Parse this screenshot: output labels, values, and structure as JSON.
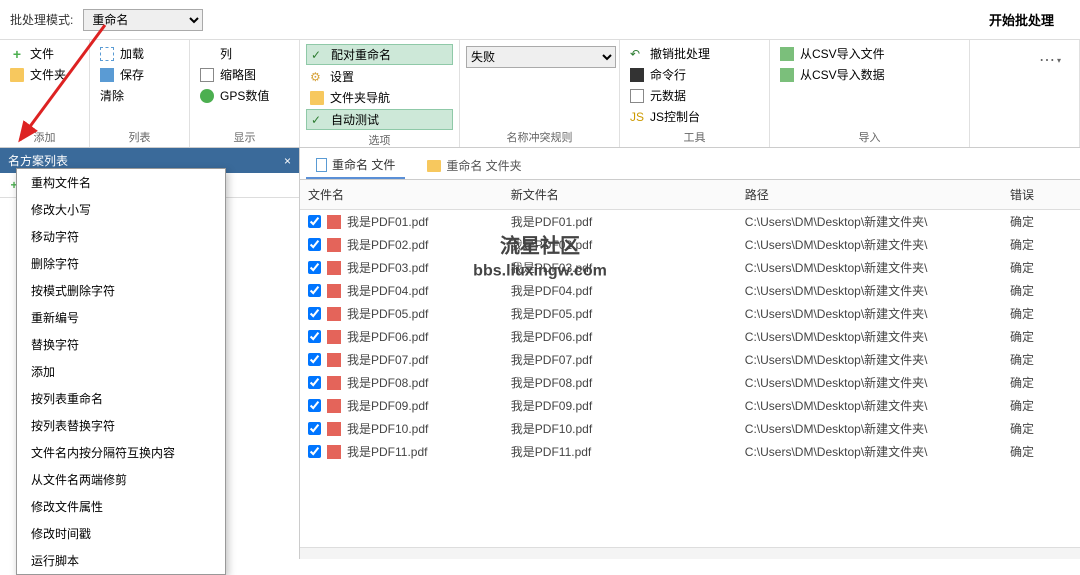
{
  "top": {
    "mode_label": "批处理模式:",
    "mode_value": "重命名",
    "start": "开始批处理"
  },
  "ribbon": {
    "add": {
      "label": "添加",
      "file": "文件",
      "folder": "文件夹"
    },
    "list": {
      "label": "列表",
      "load": "加载",
      "save": "保存",
      "clear": "清除"
    },
    "disp": {
      "label": "显示",
      "col": "列",
      "thumb": "缩略图",
      "gps": "GPS数值"
    },
    "opt": {
      "label": "选项",
      "pair": "配对重命名",
      "set": "设置",
      "nav": "文件夹导航",
      "auto": "自动测试"
    },
    "rule": {
      "label": "名称冲突规则",
      "fail": "失败"
    },
    "tool": {
      "label": "工具",
      "undo": "撤销批处理",
      "cmd": "命令行",
      "meta": "元数据",
      "js": "JS控制台"
    },
    "imp": {
      "label": "导入",
      "csvf": "从CSV导入文件",
      "csvd": "从CSV导入数据"
    }
  },
  "panel": {
    "title": "名方案列表"
  },
  "menu": [
    "重构文件名",
    "修改大小写",
    "移动字符",
    "删除字符",
    "按模式删除字符",
    "重新编号",
    "替换字符",
    "添加",
    "按列表重命名",
    "按列表替换字符",
    "文件名内按分隔符互换内容",
    "从文件名两端修剪",
    "修改文件属性",
    "修改时间戳",
    "运行脚本"
  ],
  "tabs": {
    "files": "重命名 文件",
    "folders": "重命名 文件夹"
  },
  "cols": {
    "name": "文件名",
    "newname": "新文件名",
    "path": "路径",
    "err": "错误"
  },
  "rows": [
    {
      "n": "我是PDF01.pdf",
      "nn": "我是PDF01.pdf",
      "p": "C:\\Users\\DM\\Desktop\\新建文件夹\\",
      "e": "确定"
    },
    {
      "n": "我是PDF02.pdf",
      "nn": "我是PDF02.pdf",
      "p": "C:\\Users\\DM\\Desktop\\新建文件夹\\",
      "e": "确定"
    },
    {
      "n": "我是PDF03.pdf",
      "nn": "我是PDF03.pdf",
      "p": "C:\\Users\\DM\\Desktop\\新建文件夹\\",
      "e": "确定"
    },
    {
      "n": "我是PDF04.pdf",
      "nn": "我是PDF04.pdf",
      "p": "C:\\Users\\DM\\Desktop\\新建文件夹\\",
      "e": "确定"
    },
    {
      "n": "我是PDF05.pdf",
      "nn": "我是PDF05.pdf",
      "p": "C:\\Users\\DM\\Desktop\\新建文件夹\\",
      "e": "确定"
    },
    {
      "n": "我是PDF06.pdf",
      "nn": "我是PDF06.pdf",
      "p": "C:\\Users\\DM\\Desktop\\新建文件夹\\",
      "e": "确定"
    },
    {
      "n": "我是PDF07.pdf",
      "nn": "我是PDF07.pdf",
      "p": "C:\\Users\\DM\\Desktop\\新建文件夹\\",
      "e": "确定"
    },
    {
      "n": "我是PDF08.pdf",
      "nn": "我是PDF08.pdf",
      "p": "C:\\Users\\DM\\Desktop\\新建文件夹\\",
      "e": "确定"
    },
    {
      "n": "我是PDF09.pdf",
      "nn": "我是PDF09.pdf",
      "p": "C:\\Users\\DM\\Desktop\\新建文件夹\\",
      "e": "确定"
    },
    {
      "n": "我是PDF10.pdf",
      "nn": "我是PDF10.pdf",
      "p": "C:\\Users\\DM\\Desktop\\新建文件夹\\",
      "e": "确定"
    },
    {
      "n": "我是PDF11.pdf",
      "nn": "我是PDF11.pdf",
      "p": "C:\\Users\\DM\\Desktop\\新建文件夹\\",
      "e": "确定"
    }
  ],
  "watermark": {
    "l1": "流星社区",
    "l2": "bbs.liuxingw.com"
  }
}
